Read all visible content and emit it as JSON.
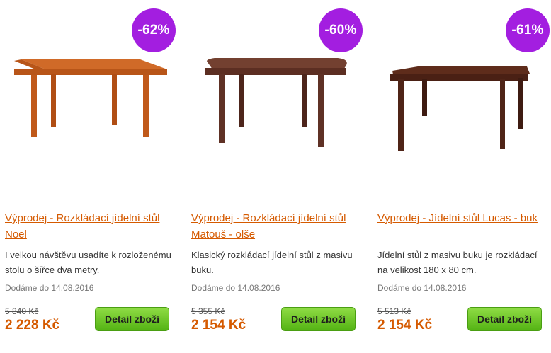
{
  "products": [
    {
      "discount": "-62%",
      "title": "Výprodej - Rozkládací jídelní stůl Noel",
      "description": "I velkou návštěvu usadíte k rozloženému stolu o šířce dva metry.",
      "delivery": "Dodáme do 14.08.2016",
      "old_price": "5 840 Kč",
      "new_price": "2 228 Kč",
      "button_label": "Detail zboží",
      "wood_color": "#c9601f"
    },
    {
      "discount": "-60%",
      "title": "Výprodej - Rozkládací jídelní stůl Matouš - olše",
      "description": "Klasický rozkládací jídelní stůl z masivu buku.",
      "delivery": "Dodáme do 14.08.2016",
      "old_price": "5 355 Kč",
      "new_price": "2 154 Kč",
      "button_label": "Detail zboží",
      "wood_color": "#6b3a2c"
    },
    {
      "discount": "-61%",
      "title": "Výprodej - Jídelní stůl Lucas - buk",
      "description": "Jídelní stůl z masivu buku je rozkládací na velikost 180 x 80 cm.",
      "delivery": "Dodáme do 14.08.2016",
      "old_price": "5 513 Kč",
      "new_price": "2 154 Kč",
      "button_label": "Detail zboží",
      "wood_color": "#5a2a1a"
    }
  ]
}
